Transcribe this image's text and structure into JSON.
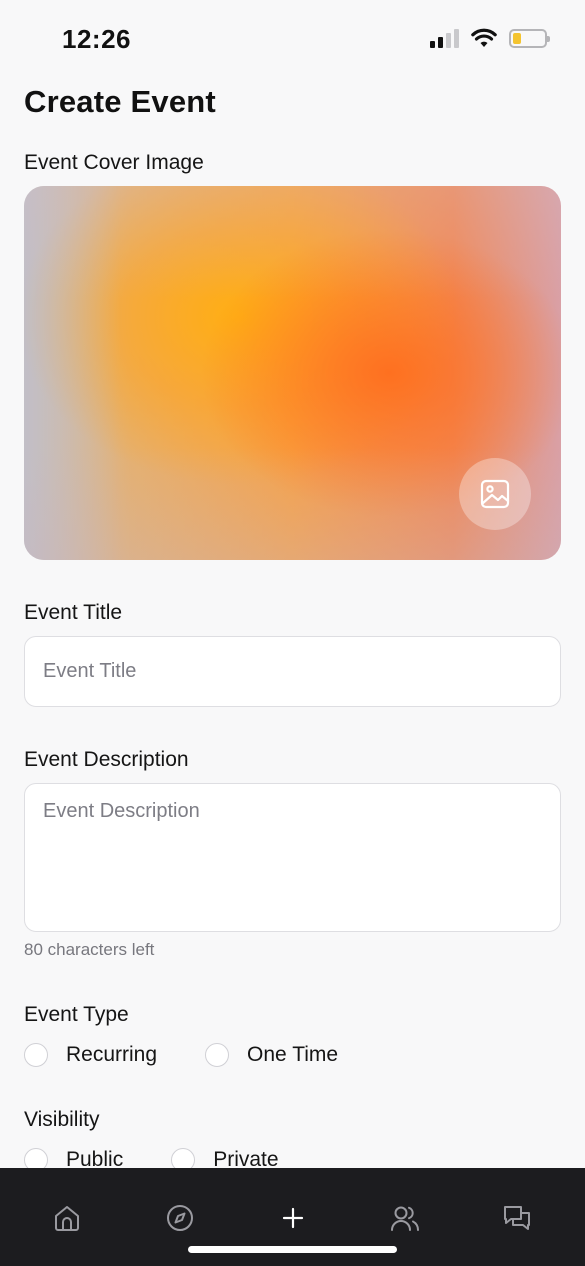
{
  "status_bar": {
    "time": "12:26"
  },
  "page": {
    "title": "Create Event"
  },
  "cover": {
    "label": "Event Cover Image",
    "button_icon": "image-icon"
  },
  "title_field": {
    "label": "Event Title",
    "placeholder": "Event Title",
    "value": ""
  },
  "description_field": {
    "label": "Event Description",
    "placeholder": "Event Description",
    "value": "",
    "helper": "80 characters left"
  },
  "event_type": {
    "label": "Event Type",
    "options": [
      "Recurring",
      "One Time"
    ]
  },
  "visibility": {
    "label": "Visibility",
    "options": [
      "Public",
      "Private"
    ]
  },
  "tab_bar": {
    "items": [
      "home-icon",
      "compass-icon",
      "plus-icon",
      "people-icon",
      "chat-icon"
    ]
  },
  "colors": {
    "background": "#f8f8f9",
    "tab_bar": "#1c1c1f",
    "battery": "#f4c430"
  }
}
